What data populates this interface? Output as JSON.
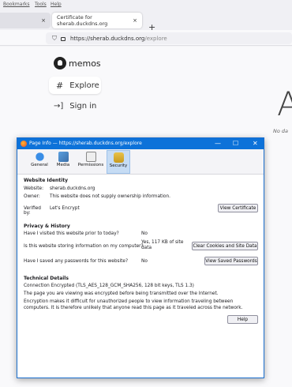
{
  "menubar": {
    "items": [
      "Bookmarks",
      "Tools",
      "Help"
    ]
  },
  "tabs": [
    {
      "label": "",
      "close": "×"
    },
    {
      "label": "Certificate for sherab.duckdns.org",
      "close": "×"
    }
  ],
  "newtab_label": "+",
  "urlbar": {
    "domain": "https://sherab.duckdns.org",
    "path": "/explore"
  },
  "page": {
    "brand": "memos",
    "nav": {
      "explore": "Explore",
      "explore_icon": "#",
      "signin": "Sign in"
    },
    "big_letter": "A",
    "no_data": "No da"
  },
  "dialog": {
    "title": "Page Info — https://sherab.duckdns.org/explore",
    "window_buttons": {
      "minimize": "—",
      "maximize": "☐",
      "close": "✕"
    },
    "toolbar": {
      "general": "General",
      "media": "Media",
      "permissions": "Permissions",
      "security": "Security"
    },
    "identity": {
      "heading": "Website Identity",
      "website_label": "Website:",
      "website_value": "sherab.duckdns.org",
      "owner_label": "Owner:",
      "owner_value": "This website does not supply ownership information.",
      "verified_label": "Verified by:",
      "verified_value": "Let's Encrypt",
      "view_cert_button": "View Certificate"
    },
    "privacy": {
      "heading": "Privacy & History",
      "q1": "Have I visited this website prior to today?",
      "a1": "No",
      "q2": "Is this website storing information on my computer?",
      "a2_line1": "Yes, 117 KB of site",
      "a2_line2": "data",
      "clear_button": "Clear Cookies and Site Data",
      "q3": "Have I saved any passwords for this website?",
      "a3": "No",
      "passwords_button": "View Saved Passwords"
    },
    "technical": {
      "heading": "Technical Details",
      "connection": "Connection Encrypted (TLS_AES_128_GCM_SHA256, 128 bit keys, TLS 1.3)",
      "line2": "The page you are viewing was encrypted before being transmitted over the Internet.",
      "line3": "Encryption makes it difficult for unauthorized people to view information traveling between computers. It is therefore unlikely that anyone read this page as it traveled across the network."
    },
    "help_button": "Help"
  }
}
